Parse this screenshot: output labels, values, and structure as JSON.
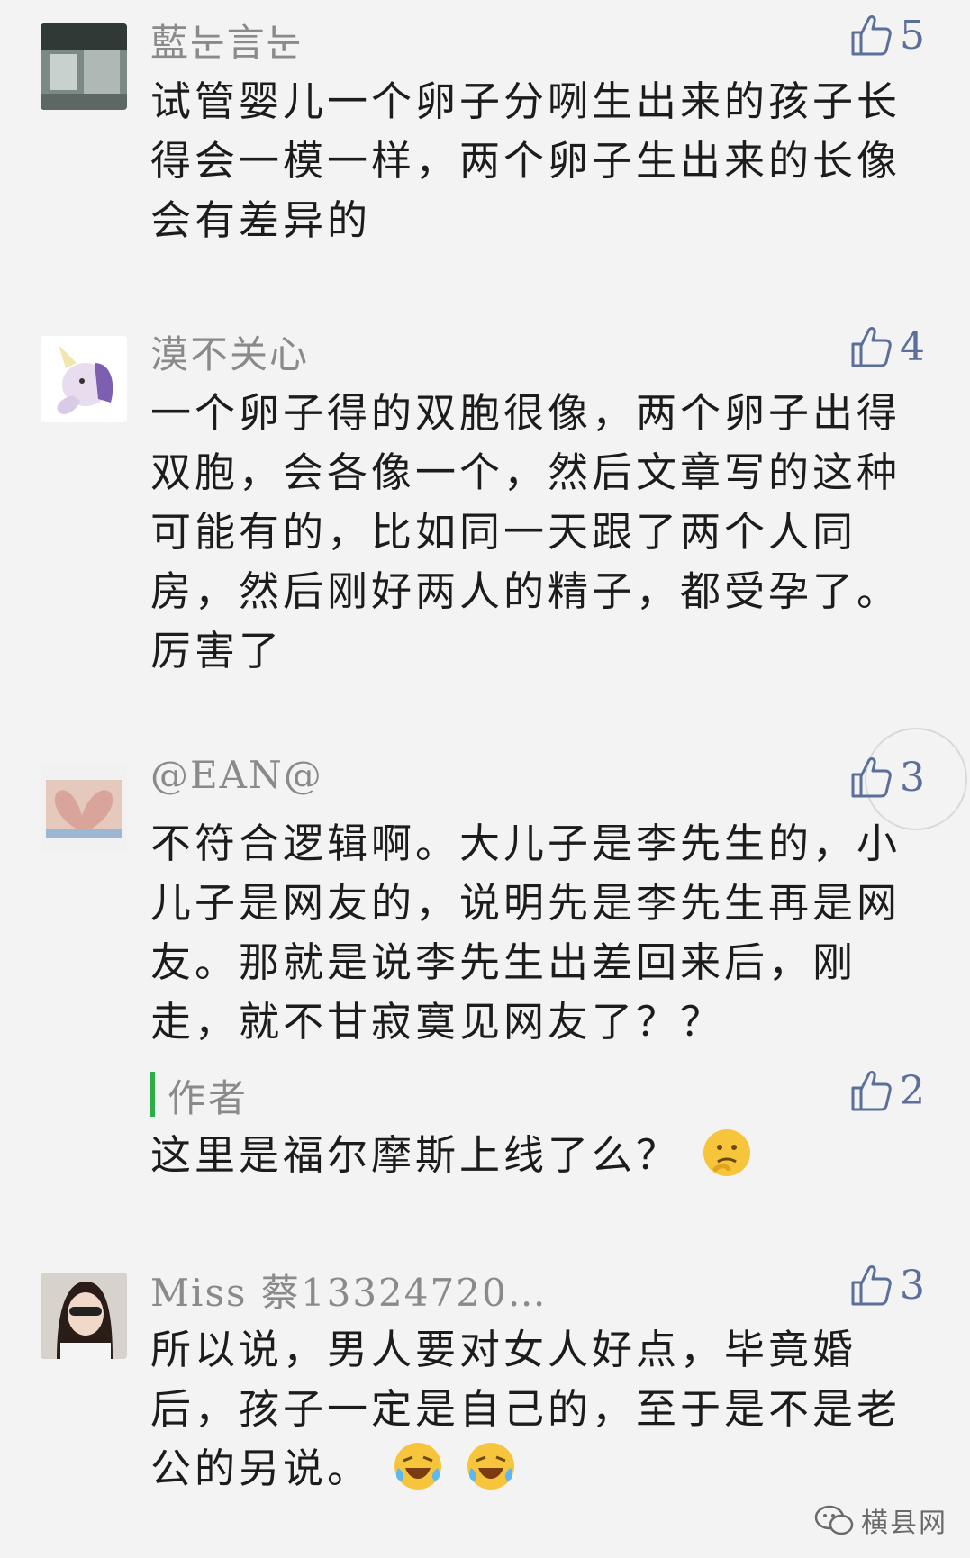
{
  "comments": [
    {
      "nickname": "藍눈言눈",
      "likes": "5",
      "text": "试管婴儿一个卵子分咧生出来的孩子长得会一模一样，两个卵子生出来的长像会有差异的"
    },
    {
      "nickname": "漠不关心",
      "likes": "4",
      "text": "一个卵子得的双胞很像，两个卵子出得双胞，会各像一个，然后文章写的这种可能有的，比如同一天跟了两个人同房，然后刚好两人的精子，都受孕了。厉害了"
    },
    {
      "nickname": "@EAN@",
      "likes": "3",
      "text": "不符合逻辑啊。大儿子是李先生的，小儿子是网友的，说明先是李先生再是网友。那就是说李先生出差回来后，刚走，就不甘寂寞见网友了？？",
      "reply": {
        "author_label": "作者",
        "likes": "2",
        "text": "这里是福尔摩斯上线了么？"
      }
    },
    {
      "nickname": "Miss 蔡13324720…",
      "likes": "3",
      "text": "所以说，男人要对女人好点，毕竟婚后，孩子一定是自己的，至于是不是老公的另说。"
    }
  ],
  "watermark": {
    "text": "横县网",
    "icon": "wechat-icon"
  },
  "icons": {
    "like": "thumbs-up-icon",
    "reply_emoji": "thinking-face-icon",
    "end_emoji": "laughing-crying-face-icon"
  },
  "colors": {
    "nickname": "#8a8a8a",
    "body_text": "#1c1c1c",
    "like": "#5b6f9a",
    "author_bar": "#2aae48",
    "background": "#f3f3f3"
  }
}
